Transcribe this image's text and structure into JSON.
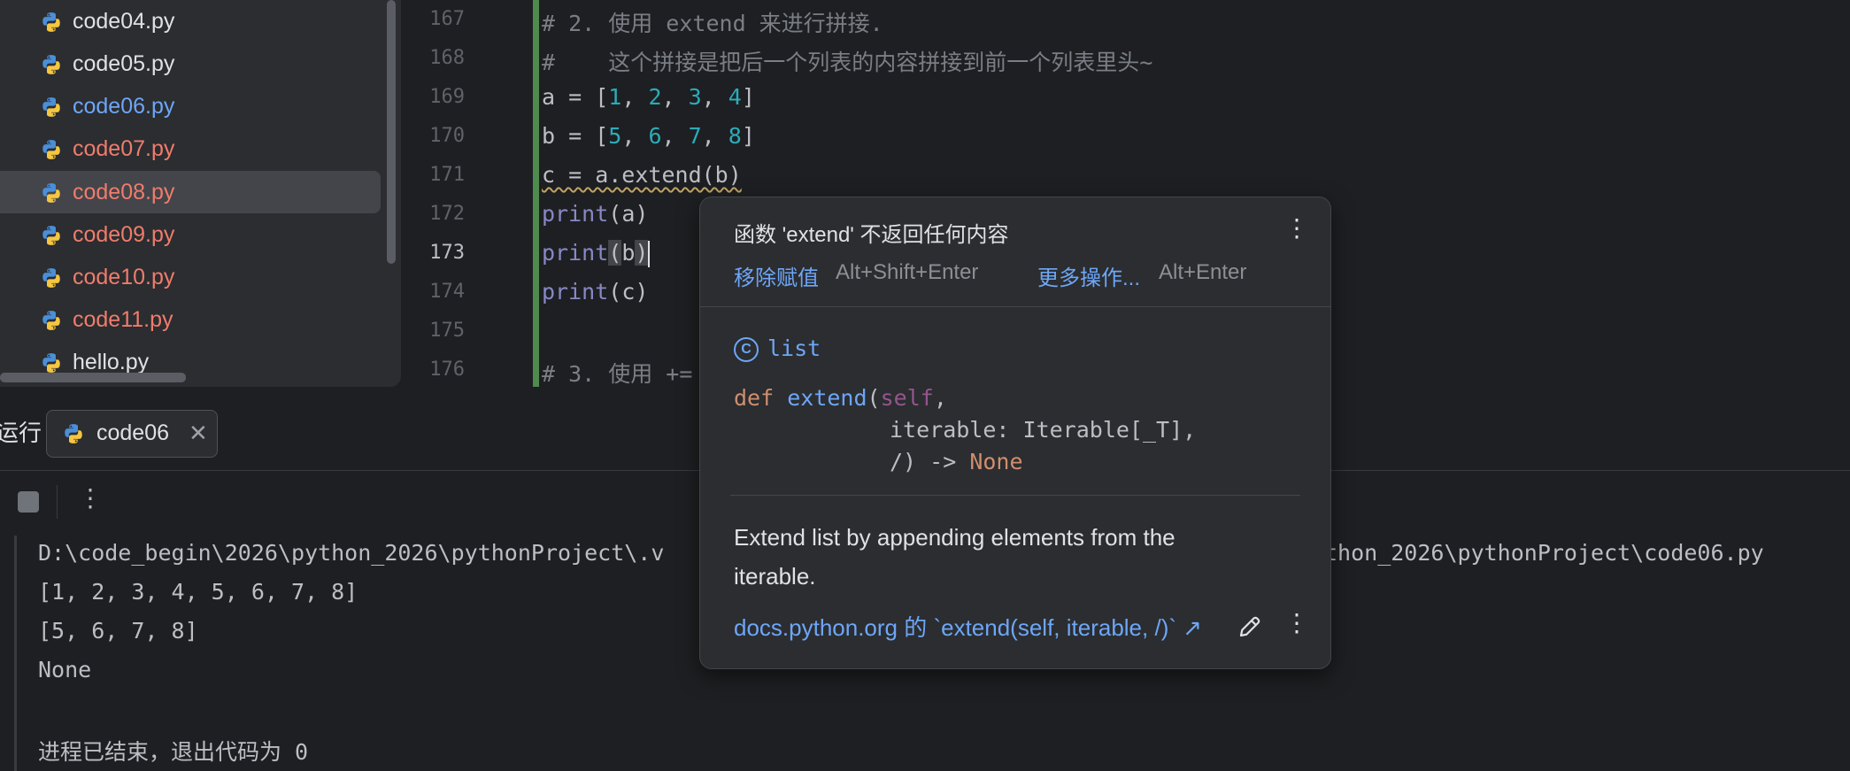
{
  "project_tree": {
    "files": [
      {
        "name": "code04.py",
        "state": "normal"
      },
      {
        "name": "code05.py",
        "state": "normal"
      },
      {
        "name": "code06.py",
        "state": "modified"
      },
      {
        "name": "code07.py",
        "state": "error"
      },
      {
        "name": "code08.py",
        "state": "error",
        "selected": true
      },
      {
        "name": "code09.py",
        "state": "error"
      },
      {
        "name": "code10.py",
        "state": "error"
      },
      {
        "name": "code11.py",
        "state": "error"
      },
      {
        "name": "hello.py",
        "state": "normal"
      }
    ]
  },
  "editor": {
    "current_line": "173",
    "lines": [
      {
        "num": "167",
        "text": "# 2. 使用 extend 来进行拼接."
      },
      {
        "num": "168",
        "text": "#    这个拼接是把后一个列表的内容拼接到前一个列表里头~"
      },
      {
        "num": "169",
        "text": "a = [1, 2, 3, 4]"
      },
      {
        "num": "170",
        "text": "b = [5, 6, 7, 8]"
      },
      {
        "num": "171",
        "text": "c = a.extend(b)"
      },
      {
        "num": "172",
        "text": "print(a)"
      },
      {
        "num": "173",
        "text": "print(b)"
      },
      {
        "num": "174",
        "text": "print(c)"
      },
      {
        "num": "175",
        "text": ""
      },
      {
        "num": "176",
        "text": "# 3. 使用 +="
      }
    ]
  },
  "run_panel": {
    "label": "运行",
    "tab_name": "code06",
    "close_glyph": "✕",
    "more_glyph": "⋮",
    "output": [
      "D:\\code_begin\\2026\\python_2026\\pythonProject\\.v",
      "[1, 2, 3, 4, 5, 6, 7, 8]",
      "[5, 6, 7, 8]",
      "None",
      "",
      "进程已结束，退出代码为 0"
    ],
    "output_line1_tail": "thon_2026\\pythonProject\\code06.py"
  },
  "popup": {
    "title": "函数 'extend' 不返回任何内容",
    "more_glyph": "⋮",
    "quickfix_primary": "移除赋值",
    "quickfix_primary_shortcut": "Alt+Shift+Enter",
    "quickfix_more": "更多操作...",
    "quickfix_more_shortcut": "Alt+Enter",
    "class_icon": "C",
    "class_name": "list",
    "signature": {
      "def_kw": "def",
      "name": "extend",
      "self": "self",
      "line2": "iterable: Iterable[_T],",
      "line3_prefix": "/) -> ",
      "return_type": "None"
    },
    "description": "Extend list by appending elements from the iterable.",
    "doc_link": "docs.python.org 的 `extend(self, iterable, /)` ↗"
  },
  "colors": {
    "accent": "#6ea6f7",
    "vcs_added_bar": "#4f8a4f",
    "error_file": "#f07c6c",
    "modified_file": "#6ea6f7"
  }
}
